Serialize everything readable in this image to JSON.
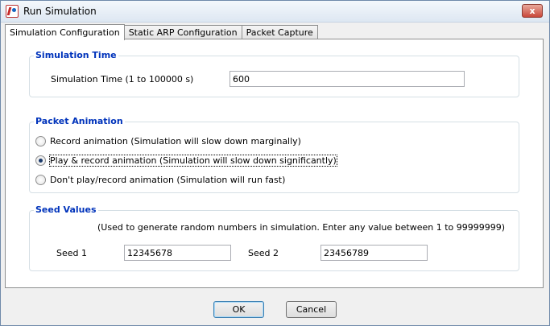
{
  "window": {
    "title": "Run Simulation",
    "close_label": "x"
  },
  "tabs": [
    {
      "label": "Simulation Configuration",
      "active": true
    },
    {
      "label": "Static ARP Configuration",
      "active": false
    },
    {
      "label": "Packet Capture",
      "active": false
    }
  ],
  "simulation_time": {
    "title": "Simulation Time",
    "field_label": "Simulation Time (1 to 100000 s)",
    "value": "600"
  },
  "packet_animation": {
    "title": "Packet Animation",
    "options": [
      {
        "label": "Record animation (Simulation will slow down marginally)",
        "checked": false
      },
      {
        "label": "Play & record animation (Simulation will slow down significantly)",
        "checked": true
      },
      {
        "label": "Don't play/record animation (Simulation will run fast)",
        "checked": false
      }
    ]
  },
  "seed_values": {
    "title": "Seed Values",
    "hint": "(Used to generate random numbers in simulation. Enter any value between 1 to 99999999)",
    "seed1_label": "Seed 1",
    "seed1_value": "12345678",
    "seed2_label": "Seed 2",
    "seed2_value": "23456789"
  },
  "buttons": {
    "ok": "OK",
    "cancel": "Cancel"
  },
  "colors": {
    "group_title": "#0033bb",
    "close_button": "#c9473a",
    "default_button_border": "#3c7fb1"
  }
}
